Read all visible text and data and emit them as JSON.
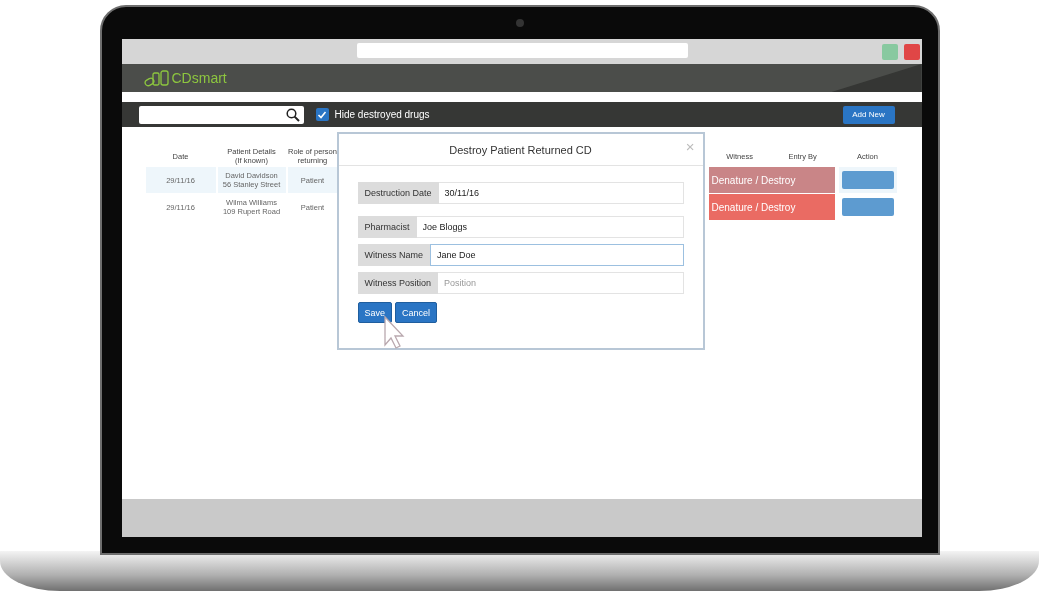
{
  "app": {
    "logo": "CDsmart"
  },
  "toolbar": {
    "hide_destroyed": {
      "label": "Hide destroyed drugs",
      "checked": true
    },
    "add_button": "Add New"
  },
  "table": {
    "columns": [
      "Date",
      "Patient Details (If known)",
      "Role of person returning",
      "Witness",
      "Entry By",
      "Action"
    ],
    "rows": [
      {
        "date": "29/11/16",
        "patient_name": "David Davidson",
        "patient_address": "56 Stanley Street",
        "role": "Patient",
        "status": "Denature / Destroy",
        "selected": true
      },
      {
        "date": "29/11/16",
        "patient_name": "Wilma Williams",
        "patient_address": "109 Rupert Road",
        "role": "Patient",
        "status": "Denature / Destroy",
        "selected": false
      }
    ]
  },
  "dialog": {
    "title": "Destroy Patient Returned CD",
    "close": "×",
    "fields": [
      {
        "label": "Destruction Date",
        "value": "30/11/16",
        "focused": false
      },
      {
        "label": "Pharmacist",
        "value": "Joe Bloggs",
        "focused": false
      },
      {
        "label": "Witness Name",
        "value": "Jane Doe",
        "focused": true
      },
      {
        "label": "Witness Position",
        "placeholder": "Position",
        "focused": false
      }
    ],
    "buttons": [
      "Save",
      "Cancel"
    ]
  }
}
